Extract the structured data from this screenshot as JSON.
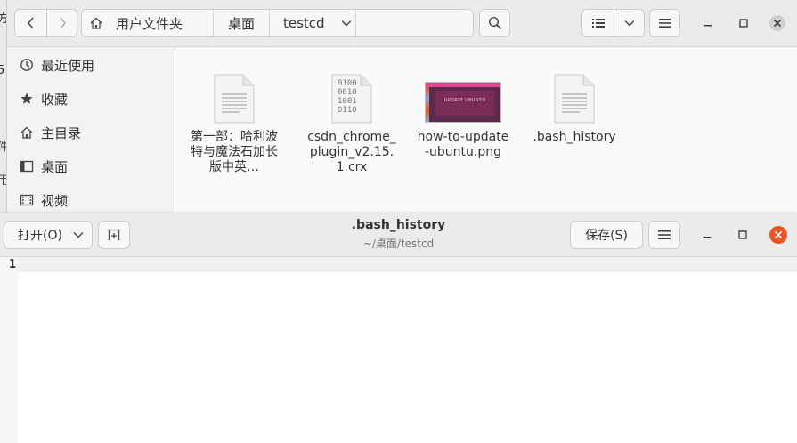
{
  "background": {
    "edge_chars": [
      "方",
      "5",
      "件",
      "用"
    ]
  },
  "file_manager": {
    "breadcrumb": {
      "home": "用户文件夹",
      "desktop": "桌面",
      "current": "testcd"
    },
    "sidebar": {
      "items": [
        {
          "label": "最近使用",
          "icon": "clock-icon"
        },
        {
          "label": "收藏",
          "icon": "star-icon"
        },
        {
          "label": "主目录",
          "icon": "home-icon"
        },
        {
          "label": "桌面",
          "icon": "desktop-icon"
        },
        {
          "label": "视频",
          "icon": "video-icon"
        }
      ]
    },
    "files": [
      {
        "name": "第一部：哈利波特与魔法石加长版中英…",
        "type": "text-document-icon"
      },
      {
        "name": "csdn_chrome_plugin_v2.15.1.crx",
        "type": "binary-file-icon",
        "binary_text": [
          "0100",
          "0010",
          "1001",
          "0110"
        ]
      },
      {
        "name": "how-to-update-ubuntu.png",
        "type": "image-thumbnail",
        "thumb_text": "UPDATE UBUNTU"
      },
      {
        "name": ".bash_history",
        "type": "text-document-icon"
      }
    ]
  },
  "editor": {
    "open_label": "打开(O)",
    "title": ".bash_history",
    "subtitle": "~/桌面/testcd",
    "save_label": "保存(S)",
    "line_number": "1",
    "close_color": "#e95420"
  }
}
